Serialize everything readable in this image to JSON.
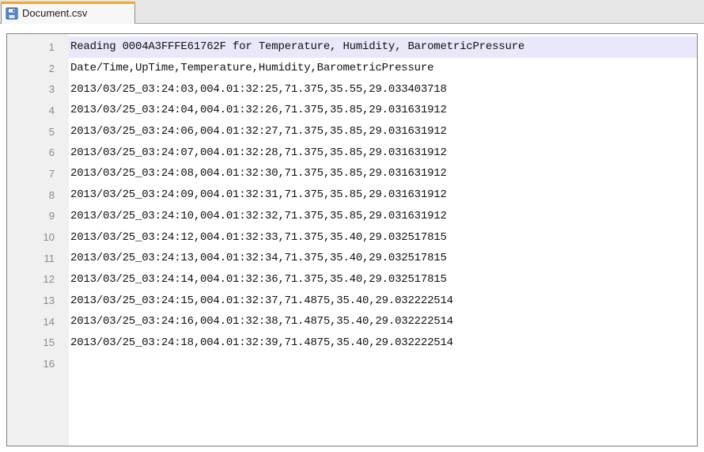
{
  "tab": {
    "label": "Document.csv",
    "icon": "save-disk-icon",
    "accent_color": "#f5a623"
  },
  "editor": {
    "current_line": 1,
    "lines": [
      {
        "num": "1",
        "text": "Reading 0004A3FFFE61762F for Temperature, Humidity, BarometricPressure"
      },
      {
        "num": "2",
        "text": "Date/Time,UpTime,Temperature,Humidity,BarometricPressure"
      },
      {
        "num": "3",
        "text": "2013/03/25_03:24:03,004.01:32:25,71.375,35.55,29.033403718"
      },
      {
        "num": "4",
        "text": "2013/03/25_03:24:04,004.01:32:26,71.375,35.85,29.031631912"
      },
      {
        "num": "5",
        "text": "2013/03/25_03:24:06,004.01:32:27,71.375,35.85,29.031631912"
      },
      {
        "num": "6",
        "text": "2013/03/25_03:24:07,004.01:32:28,71.375,35.85,29.031631912"
      },
      {
        "num": "7",
        "text": "2013/03/25_03:24:08,004.01:32:30,71.375,35.85,29.031631912"
      },
      {
        "num": "8",
        "text": "2013/03/25_03:24:09,004.01:32:31,71.375,35.85,29.031631912"
      },
      {
        "num": "9",
        "text": "2013/03/25_03:24:10,004.01:32:32,71.375,35.85,29.031631912"
      },
      {
        "num": "10",
        "text": "2013/03/25_03:24:12,004.01:32:33,71.375,35.40,29.032517815"
      },
      {
        "num": "11",
        "text": "2013/03/25_03:24:13,004.01:32:34,71.375,35.40,29.032517815"
      },
      {
        "num": "12",
        "text": "2013/03/25_03:24:14,004.01:32:36,71.375,35.40,29.032517815"
      },
      {
        "num": "13",
        "text": "2013/03/25_03:24:15,004.01:32:37,71.4875,35.40,29.032222514"
      },
      {
        "num": "14",
        "text": "2013/03/25_03:24:16,004.01:32:38,71.4875,35.40,29.032222514"
      },
      {
        "num": "15",
        "text": "2013/03/25_03:24:18,004.01:32:39,71.4875,35.40,29.032222514"
      },
      {
        "num": "16",
        "text": ""
      }
    ]
  }
}
